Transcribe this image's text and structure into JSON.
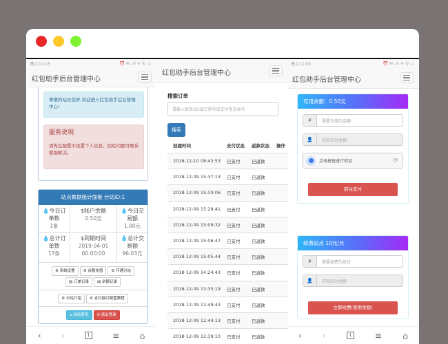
{
  "window": {
    "colors": {
      "close": "#e8262a",
      "min": "#fdc82a",
      "max": "#7ef22e"
    }
  },
  "status_bar": {
    "time": "晚上11:05",
    "icons": "⏰ ✉ .ııl ᯤ ① ▭"
  },
  "app_title": "红包助手后台管理中心",
  "left": {
    "welcome": "尊敬的站长您好,欢迎进入红包助手后台管理中心!",
    "service_title": "服务说明",
    "service_text": "请先在配置中设置个人信息，如有问题可联系客服解决。",
    "panel_title": "站点数据统计面板 分站ID:1",
    "stats": [
      {
        "icon": "💧",
        "label": "今日订单数",
        "value": "1条"
      },
      {
        "icon": "$",
        "label": "账户余额",
        "value": "0.50元"
      },
      {
        "icon": "💧",
        "label": "今日交易额",
        "value": "1.00元"
      },
      {
        "icon": "💧",
        "label": "总计订单数",
        "value": "17条"
      },
      {
        "icon": "$",
        "label": "到期时间",
        "value": "2019-04-01 00:00:00"
      },
      {
        "icon": "💧",
        "label": "总计交易额",
        "value": "96.03元"
      }
    ],
    "buttons1": [
      "系统设置",
      "余额充值",
      "开通分站"
    ],
    "buttons2": [
      "订单记录",
      "余额记录"
    ],
    "buttons3": [
      "分站介绍",
      "支付接口配置教程"
    ],
    "home_btn": "网站首页",
    "logout_btn": "退出登录"
  },
  "middle": {
    "search_label": "搜索订单",
    "search_placeholder": "请输入联系QQ或订单号或支付宝交易号",
    "search_btn": "搜索",
    "columns": [
      "创建时间",
      "支付状态",
      "返款状态",
      "操作"
    ],
    "rows": [
      [
        "2018-12-10 08:43:53",
        "已支付",
        "已返款"
      ],
      [
        "2018-12-09 15:37:13",
        "已支付",
        "已返款"
      ],
      [
        "2018-12-09 15:30:06",
        "已支付",
        "已返款"
      ],
      [
        "2018-12-09 15:28:41",
        "已支付",
        "已返款"
      ],
      [
        "2018-12-09 15:09:32",
        "已支付",
        "已返款"
      ],
      [
        "2018-12-09 15:06:47",
        "已支付",
        "已返款"
      ],
      [
        "2018-12-09 15:05:44",
        "已支付",
        "已返款"
      ],
      [
        "2018-12-09 14:24:43",
        "已支付",
        "已返款"
      ],
      [
        "2018-12-09 13:35:19",
        "已支付",
        "已返款"
      ],
      [
        "2018-12-09 12:49:43",
        "已支付",
        "已返款"
      ],
      [
        "2018-12-09 12:44:13",
        "已支付",
        "已返款"
      ],
      [
        "2018-12-09 12:39:10",
        "已支付",
        "已返款"
      ]
    ]
  },
  "right": {
    "balance_title": "可用余额：0.50元",
    "amount_placeholder": "需要充值的金额",
    "actual_placeholder": "实际应付金额",
    "captcha": "点击按钮进行验证",
    "pay_btn": "前往支付",
    "renew_title": "续费站点 10元/月",
    "months_placeholder": "需要续费的月份",
    "actual2_placeholder": "实际应付金额",
    "renew_btn": "立即续费(使用余额)",
    "yen": "¥"
  },
  "nav": {
    "back": "‹",
    "forward": "›",
    "tabs": "1",
    "menu": "≡",
    "home": "⌂"
  }
}
